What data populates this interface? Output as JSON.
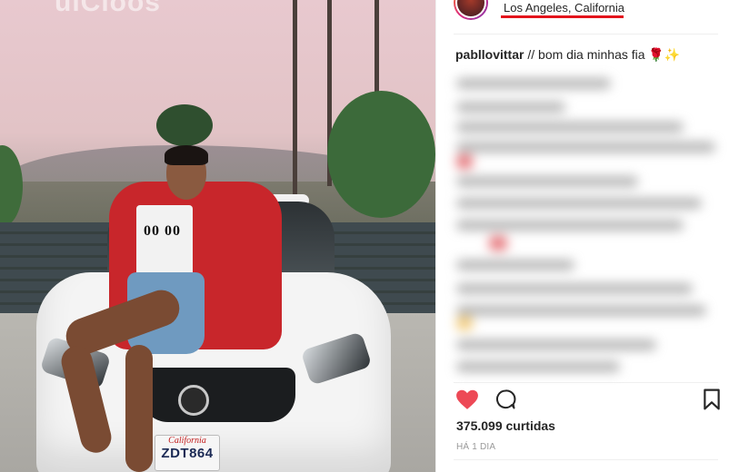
{
  "photo": {
    "watermark": "uiCioos",
    "shirt_text": "00 00",
    "plate_state": "California",
    "plate_number": "ZDT864"
  },
  "post": {
    "location": "Los Angeles, California",
    "annotation_color": "#e3131b",
    "caption": {
      "username": "pabllovittar",
      "text": " // bom dia minhas fia ",
      "emoji_rose": "🌹",
      "emoji_sparkles": "✨"
    },
    "likes": "375.099 curtidas",
    "timestamp": "HÁ 1 DIA",
    "liked": true,
    "heart_color": "#ed4956",
    "icons": [
      "heart-icon",
      "comment-icon",
      "bookmark-icon"
    ]
  }
}
